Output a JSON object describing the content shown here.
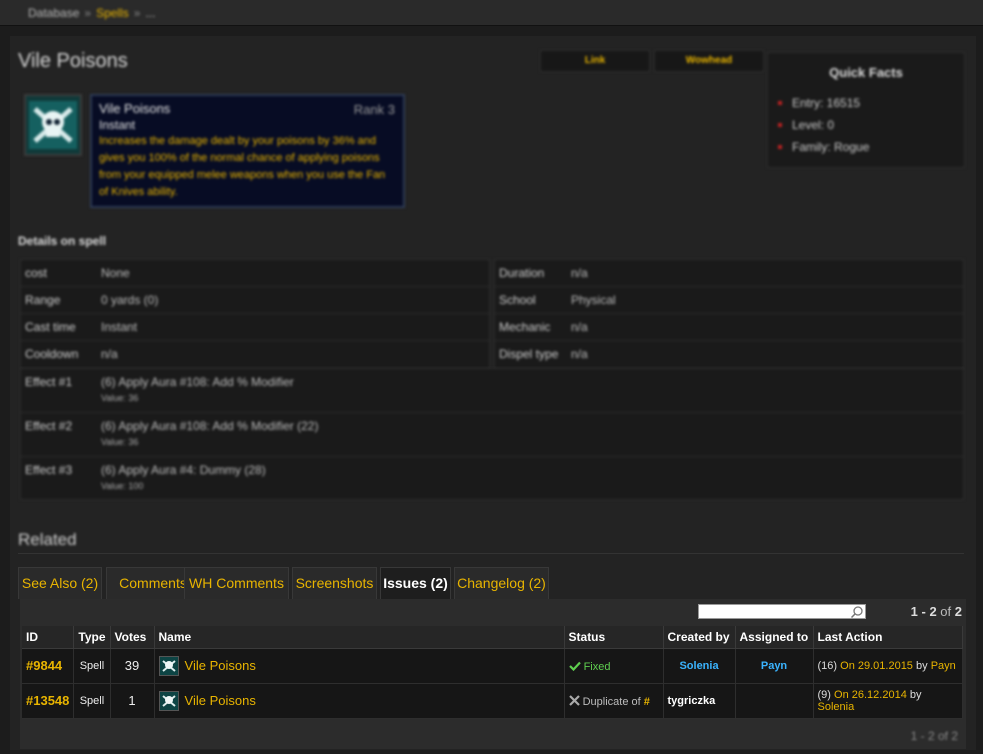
{
  "breadcrumb": {
    "root": "Database",
    "section": "Spells",
    "more": "..."
  },
  "page": {
    "title": "Vile Poisons"
  },
  "buttons": {
    "link": "Link",
    "wowhead": "Wowhead"
  },
  "quick_facts": {
    "title": "Quick Facts",
    "items": [
      "Entry: 16515",
      "Level: 0",
      "Family: Rogue"
    ]
  },
  "tooltip": {
    "name": "Vile Poisons",
    "rank": "Rank 3",
    "cast": "Instant",
    "description": "Increases the damage dealt by your poisons by 36% and gives you 100% of the normal chance of applying poisons from your equipped melee weapons when you use the Fan of Knives ability."
  },
  "details": {
    "label": "Details on spell",
    "left": [
      {
        "k": "cost",
        "v": "None"
      },
      {
        "k": "Range",
        "v": "0 yards (0)"
      },
      {
        "k": "Cast time",
        "v": "Instant"
      },
      {
        "k": "Cooldown",
        "v": "n/a"
      }
    ],
    "right": [
      {
        "k": "Duration",
        "v": "n/a"
      },
      {
        "k": "School",
        "v": "Physical"
      },
      {
        "k": "Mechanic",
        "v": "n/a"
      },
      {
        "k": "Dispel type",
        "v": "n/a"
      }
    ],
    "effects": [
      {
        "k": "Effect #1",
        "v": "(6) Apply Aura #108: Add % Modifier",
        "sub": "Value: 36"
      },
      {
        "k": "Effect #2",
        "v": "(6) Apply Aura #108: Add % Modifier (22)",
        "sub": "Value: 36"
      },
      {
        "k": "Effect #3",
        "v": "(6) Apply Aura #4: Dummy (28)",
        "sub": "Value: 100"
      }
    ]
  },
  "related": {
    "title": "Related",
    "tabs": [
      {
        "label": "See Also (2)"
      },
      {
        "label": "Comments"
      },
      {
        "label": "WH Comments"
      },
      {
        "label": "Screenshots"
      },
      {
        "label": "Issues (2)"
      },
      {
        "label": "Changelog (2)"
      }
    ],
    "active_tab": "Issues (2)"
  },
  "issues": {
    "search_value": "",
    "pager": {
      "range": "1 - 2",
      "of": "of",
      "total": "2"
    },
    "pager_bottom": "1 - 2 of 2",
    "columns": [
      "ID",
      "Type",
      "Votes",
      "Name",
      "Status",
      "Created by",
      "Assigned to",
      "Last Action"
    ],
    "rows": [
      {
        "id": "#9844",
        "type": "Spell",
        "votes": "39",
        "name": "Vile Poisons",
        "status_text": "Fixed",
        "created_by": "Solenia",
        "assigned_to": "Payn",
        "last_count": "(16)",
        "last_on": "On 29.01.2015",
        "last_by": "by",
        "last_user": "Payn"
      },
      {
        "id": "#13548",
        "type": "Spell",
        "votes": "1",
        "name": "Vile Poisons",
        "status_text": "Duplicate of",
        "status_hash": "#",
        "created_by": "tygriczka",
        "assigned_to": "",
        "last_count": "(9)",
        "last_on": "On 26.12.2014",
        "last_by": "by",
        "last_user": "Solenia"
      }
    ]
  },
  "colors": {
    "accent": "#e8b400",
    "blue": "#3ab4ff",
    "green": "#5fcf4f"
  }
}
